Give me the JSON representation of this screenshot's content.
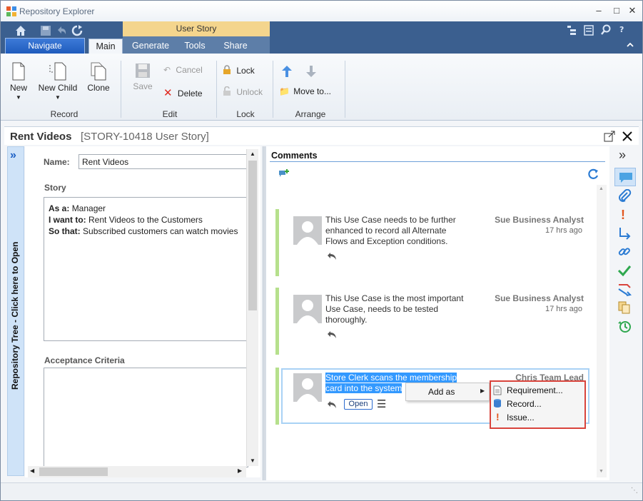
{
  "window": {
    "title": "Repository Explorer"
  },
  "ribbon": {
    "context_tab": "User Story",
    "navigate": "Navigate",
    "tabs": [
      "Main",
      "Generate",
      "Tools",
      "Share"
    ],
    "buttons": {
      "new": "New",
      "new_child": "New Child",
      "clone": "Clone",
      "save": "Save",
      "cancel": "Cancel",
      "delete": "Delete",
      "lock": "Lock",
      "unlock": "Unlock",
      "move_to": "Move to..."
    },
    "groups": [
      "Record",
      "Edit",
      "Lock",
      "Arrange"
    ]
  },
  "document": {
    "title": "Rent Videos",
    "subtitle": "[STORY-10418 User Story]"
  },
  "repo_tree": {
    "label": "Repository Tree - Click here to Open"
  },
  "form": {
    "name_label": "Name:",
    "name_value": "Rent Videos",
    "story_label": "Story",
    "story": [
      {
        "key": "As a:",
        "value": "Manager"
      },
      {
        "key": "I want to:",
        "value": "Rent Videos to the Customers"
      },
      {
        "key": "So that:",
        "value": "Subscribed customers can watch movies"
      }
    ],
    "acceptance_label": "Acceptance Criteria"
  },
  "comments": {
    "title": "Comments",
    "items": [
      {
        "text": [
          "This Use Case needs to be further",
          "enhanced to record all Alternate",
          "Flows and Exception conditions."
        ],
        "author": "Sue Business Analyst",
        "time": "17 hrs ago"
      },
      {
        "text": [
          "This Use Case is the most important",
          "Use Case, needs to be tested",
          "thoroughly."
        ],
        "author": "Sue Business Analyst",
        "time": "17 hrs ago"
      },
      {
        "text": [
          "Store Clerk scans the membership",
          "card into the system"
        ],
        "author": "Chris Team Lead",
        "open": "Open"
      }
    ]
  },
  "context_menu": {
    "add_as": "Add as",
    "submenu": [
      "Requirement...",
      "Record...",
      "Issue..."
    ]
  },
  "colors": {
    "ribbon": "#3b5f8f",
    "context_tab": "#f4d58d",
    "navigate": "#2b6bd0",
    "selection": "#3399ff",
    "comment_bar": "#b6e08c",
    "highlight_border": "#d9443c"
  }
}
